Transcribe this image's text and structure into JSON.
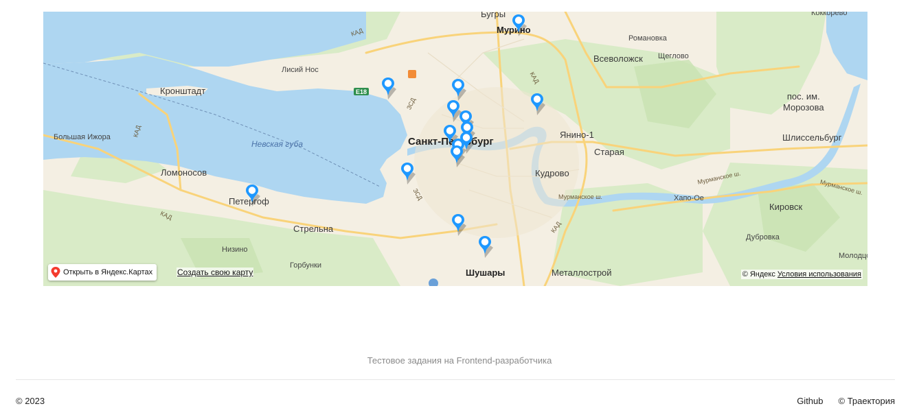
{
  "map": {
    "labels": {
      "bugry": "Бугры",
      "kokkorevo": "Коккорево",
      "murino": "Мурино",
      "romanovka": "Романовка",
      "vsevolozhsk": "Всеволожск",
      "shcheglovo": "Щеглово",
      "lisiy_nos": "Лисий Нос",
      "kronshtadt": "Кронштадт",
      "pos_morozova": "пос. им.\nМорозова",
      "bolshaya_izhora": "Большая Ижора",
      "nevskaya_guba": "Невская губа",
      "spb": "Санкт-Петербург",
      "yanino": "Янино-1",
      "shlisselburg": "Шлиссельбург",
      "staraya": "Старая",
      "lomonosov": "Ломоносов",
      "kudrovo": "Кудрово",
      "peterhof": "Петергоф",
      "khapo_oe": "Хапо-Ое",
      "kirovsk": "Кировск",
      "strelna": "Стрельна",
      "nizino": "Низино",
      "dubrovka": "Дубровка",
      "gorbunki": "Горбунки",
      "shushary": "Шушары",
      "metallostroy": "Металлострой",
      "molodtsovo": "Молодцово"
    },
    "roads": {
      "kad": "КАД",
      "zsd": "ЗСД",
      "e18": "E18",
      "murmansk": "Мурманское ш."
    },
    "open_button": "Открыть в Яндекс.Картах",
    "create_map": "Создать свою карту",
    "copyright": "© Яндекс",
    "terms": "Условия использования",
    "marker_color": "#1e98ff",
    "marker_count": 15
  },
  "note": "Тестовое задания на Frontend-разработчика",
  "footer": {
    "year": "© 2023",
    "github": "Github",
    "company": "© Траектория"
  }
}
